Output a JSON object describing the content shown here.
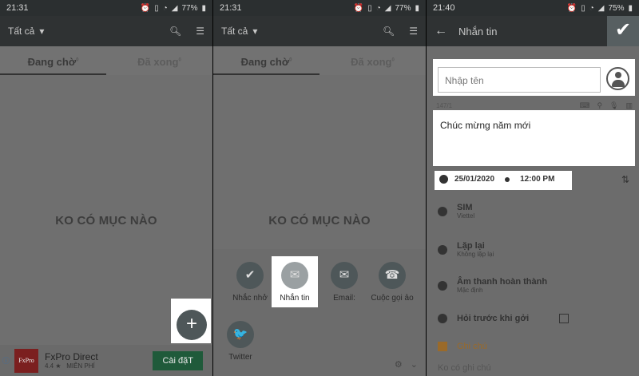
{
  "status": {
    "p1_time": "21:31",
    "p2_time": "21:31",
    "p3_time": "21:40",
    "p1_battery": "77%",
    "p2_battery": "77%",
    "p3_battery": "75%"
  },
  "list_screen": {
    "filter_label": "Tất cả",
    "tab_pending": "Đang chờ",
    "tab_done": "Đã xong",
    "tab_pending_count": "0",
    "tab_done_count": "0",
    "empty_text": "KO CÓ MỤC NÀO"
  },
  "ad": {
    "info": "ⓘ",
    "logo_text": "FxPro",
    "title": "FxPro Direct",
    "rating": "4.4 ★",
    "price": "MIỄN PHÍ",
    "install": "Cài đặT"
  },
  "options": [
    {
      "label": "Nhắc nhở",
      "icon": "✔"
    },
    {
      "label": "Nhắn tin",
      "icon": "✉"
    },
    {
      "label": "Email:",
      "icon": "✉"
    },
    {
      "label": "Cuộc gọi ảo",
      "icon": "☎"
    },
    {
      "label": "Twitter",
      "icon": "🐦"
    }
  ],
  "compose": {
    "back": "←",
    "title": "Nhắn tin",
    "name_placeholder": "Nhập tên",
    "counter": "147/1",
    "message": "Chúc mừng năm mới",
    "date": "25/01/2020",
    "time": "12:00 PM",
    "sim_label": "SIM",
    "sim_value": "Viettel",
    "repeat_label": "Lặp lại",
    "repeat_value": "Không lặp lại",
    "sound_label": "Âm thanh hoàn thành",
    "sound_value": "Mặc định",
    "ask_label": "Hỏi trước khi gởi",
    "note_label": "Ghi chú",
    "note_placeholder": "Ko có ghi chú"
  }
}
